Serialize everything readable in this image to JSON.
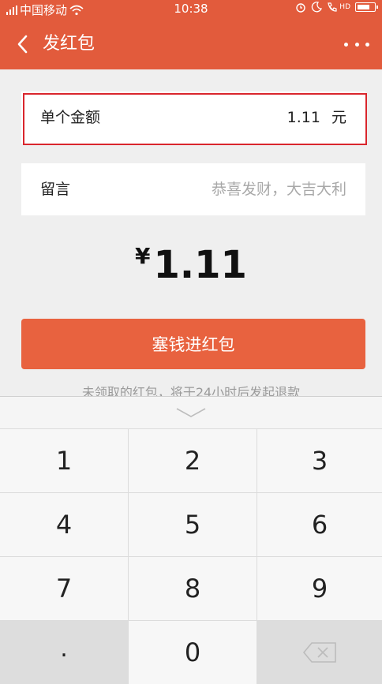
{
  "status_bar": {
    "carrier": "中国移动",
    "time": "10:38",
    "hd_label": "HD"
  },
  "nav": {
    "title": "发红包"
  },
  "amount_card": {
    "label": "单个金额",
    "value": "1.11",
    "unit": "元"
  },
  "message_card": {
    "label": "留言",
    "placeholder": "恭喜发财，大吉大利"
  },
  "total": {
    "currency": "¥",
    "value": "1.11"
  },
  "submit": {
    "label": "塞钱进红包"
  },
  "notice": "未领取的红包，将于24小时后发起退款",
  "keypad": {
    "keys": [
      "1",
      "2",
      "3",
      "4",
      "5",
      "6",
      "7",
      "8",
      "9",
      ".",
      "0"
    ]
  },
  "colors": {
    "brand": "#e25b3c",
    "button": "#e8623f",
    "highlight_border": "#d9262d"
  },
  "icons": [
    "back-icon",
    "more-icon",
    "signal-icon",
    "wifi-icon",
    "alarm-icon",
    "moon-icon",
    "call-icon",
    "battery-icon",
    "chevron-down-icon",
    "backspace-icon"
  ]
}
